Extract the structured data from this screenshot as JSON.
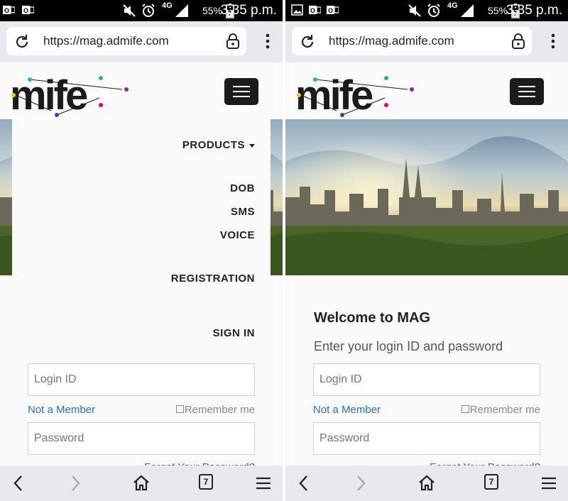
{
  "status_bar": {
    "battery_percent": "55%",
    "time": "3:35 p.m.",
    "network": "4G",
    "icons": [
      "outlook-icon",
      "mute-icon",
      "alarm-icon",
      "signal-icon",
      "battery-charging-icon"
    ]
  },
  "browser": {
    "url": "https://mag.admife.com",
    "tab_count": "7",
    "icons": [
      "reload-icon",
      "lock-icon",
      "more-vert-icon",
      "back-icon",
      "forward-icon",
      "home-icon",
      "tabs-icon",
      "menu-icon"
    ]
  },
  "site": {
    "logo_text": "mife",
    "colors": {
      "logo_text": "#1b1b1b",
      "link": "#2a6ebb",
      "button_bg": "#1b1b1b"
    }
  },
  "nav_menu": {
    "products": "PRODUCTS",
    "dob": "DOB",
    "sms": "SMS",
    "voice": "VOICE",
    "registration": "REGISTRATION",
    "sign_in": "SIGN IN"
  },
  "login": {
    "welcome": "Welcome to MAG",
    "subtitle": "Enter your login ID and password",
    "login_placeholder": "Login ID",
    "password_placeholder": "Password",
    "not_member": "Not a Member",
    "remember_me": "Remember me",
    "forgot_password": "Forgot Your Password?"
  }
}
